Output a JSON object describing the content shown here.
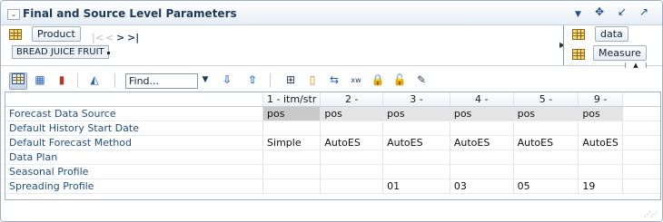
{
  "panel": {
    "title": "Final and Source Level Parameters",
    "toolbar_icons": [
      "chevron-down-icon",
      "move-icon",
      "minimize-icon",
      "maximize-icon"
    ]
  },
  "pivot": {
    "row_dimension": "Product",
    "row_member": "BREAD JUICE FRUIT",
    "side": {
      "page_dimension": "data",
      "column_dimension": "Measure"
    }
  },
  "toolbar": {
    "find_placeholder": "Find...",
    "icons": [
      "table-view-icon",
      "chart-table-view-icon",
      "chart-view-icon",
      "area-chart-icon",
      "find-dropdown-icon",
      "find-next-icon",
      "find-previous-icon",
      "pivot-icon",
      "bookmark-icon",
      "swap-icon",
      "xml-icon",
      "lock-icon",
      "unlock-icon",
      "edit-icon"
    ]
  },
  "table": {
    "columns": [
      "1 - itm/str",
      "2 -",
      "3 -",
      "4 -",
      "5 -",
      "9 -"
    ],
    "rows": [
      {
        "label": "Forecast Data Source",
        "cells": [
          "pos",
          "pos",
          "pos",
          "pos",
          "pos",
          "pos"
        ]
      },
      {
        "label": "Default History Start Date",
        "cells": [
          "",
          "",
          "",
          "",
          "",
          ""
        ]
      },
      {
        "label": "Default Forecast Method",
        "cells": [
          "Simple",
          "AutoES",
          "AutoES",
          "AutoES",
          "AutoES",
          "AutoES"
        ]
      },
      {
        "label": "Data Plan",
        "cells": [
          "",
          "",
          "",
          "",
          "",
          ""
        ]
      },
      {
        "label": "Seasonal Profile",
        "cells": [
          "",
          "",
          "",
          "",
          "",
          ""
        ]
      },
      {
        "label": "Spreading Profile",
        "cells": [
          "",
          "",
          "01",
          "03",
          "05",
          "19"
        ]
      }
    ]
  }
}
